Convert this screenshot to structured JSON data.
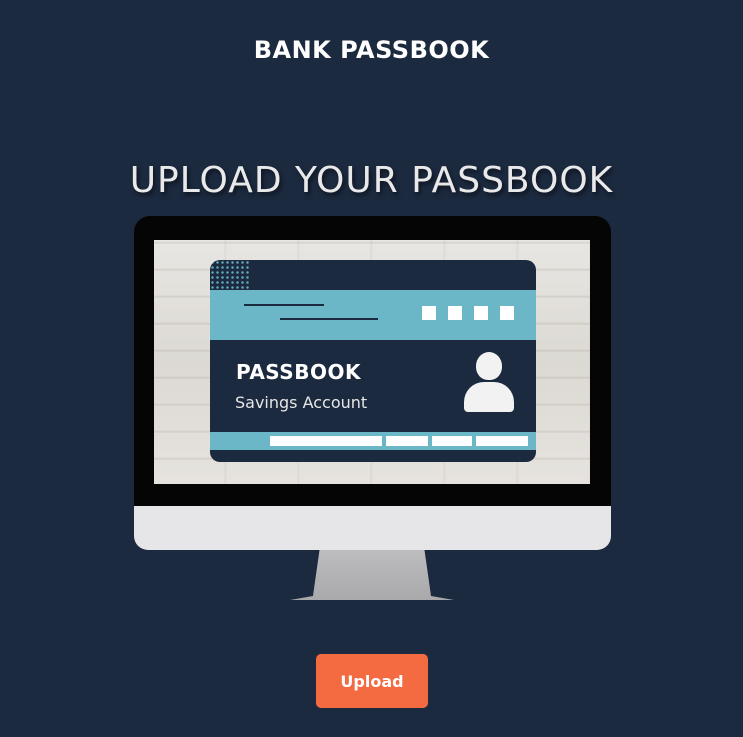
{
  "header": {
    "title": "BANK PASSBOOK"
  },
  "hero": {
    "title": "UPLOAD YOUR PASSBOOK"
  },
  "illustration": {
    "card_title": "PASSBOOK",
    "card_subtitle": "Savings Account",
    "icons": [
      "monitor-icon",
      "passbook-card-icon",
      "person-icon"
    ]
  },
  "actions": {
    "upload_label": "Upload"
  },
  "colors": {
    "background": "#1c2a40",
    "accent": "#f46a41",
    "card_band": "#6bb7c8",
    "text": "#ffffff"
  }
}
